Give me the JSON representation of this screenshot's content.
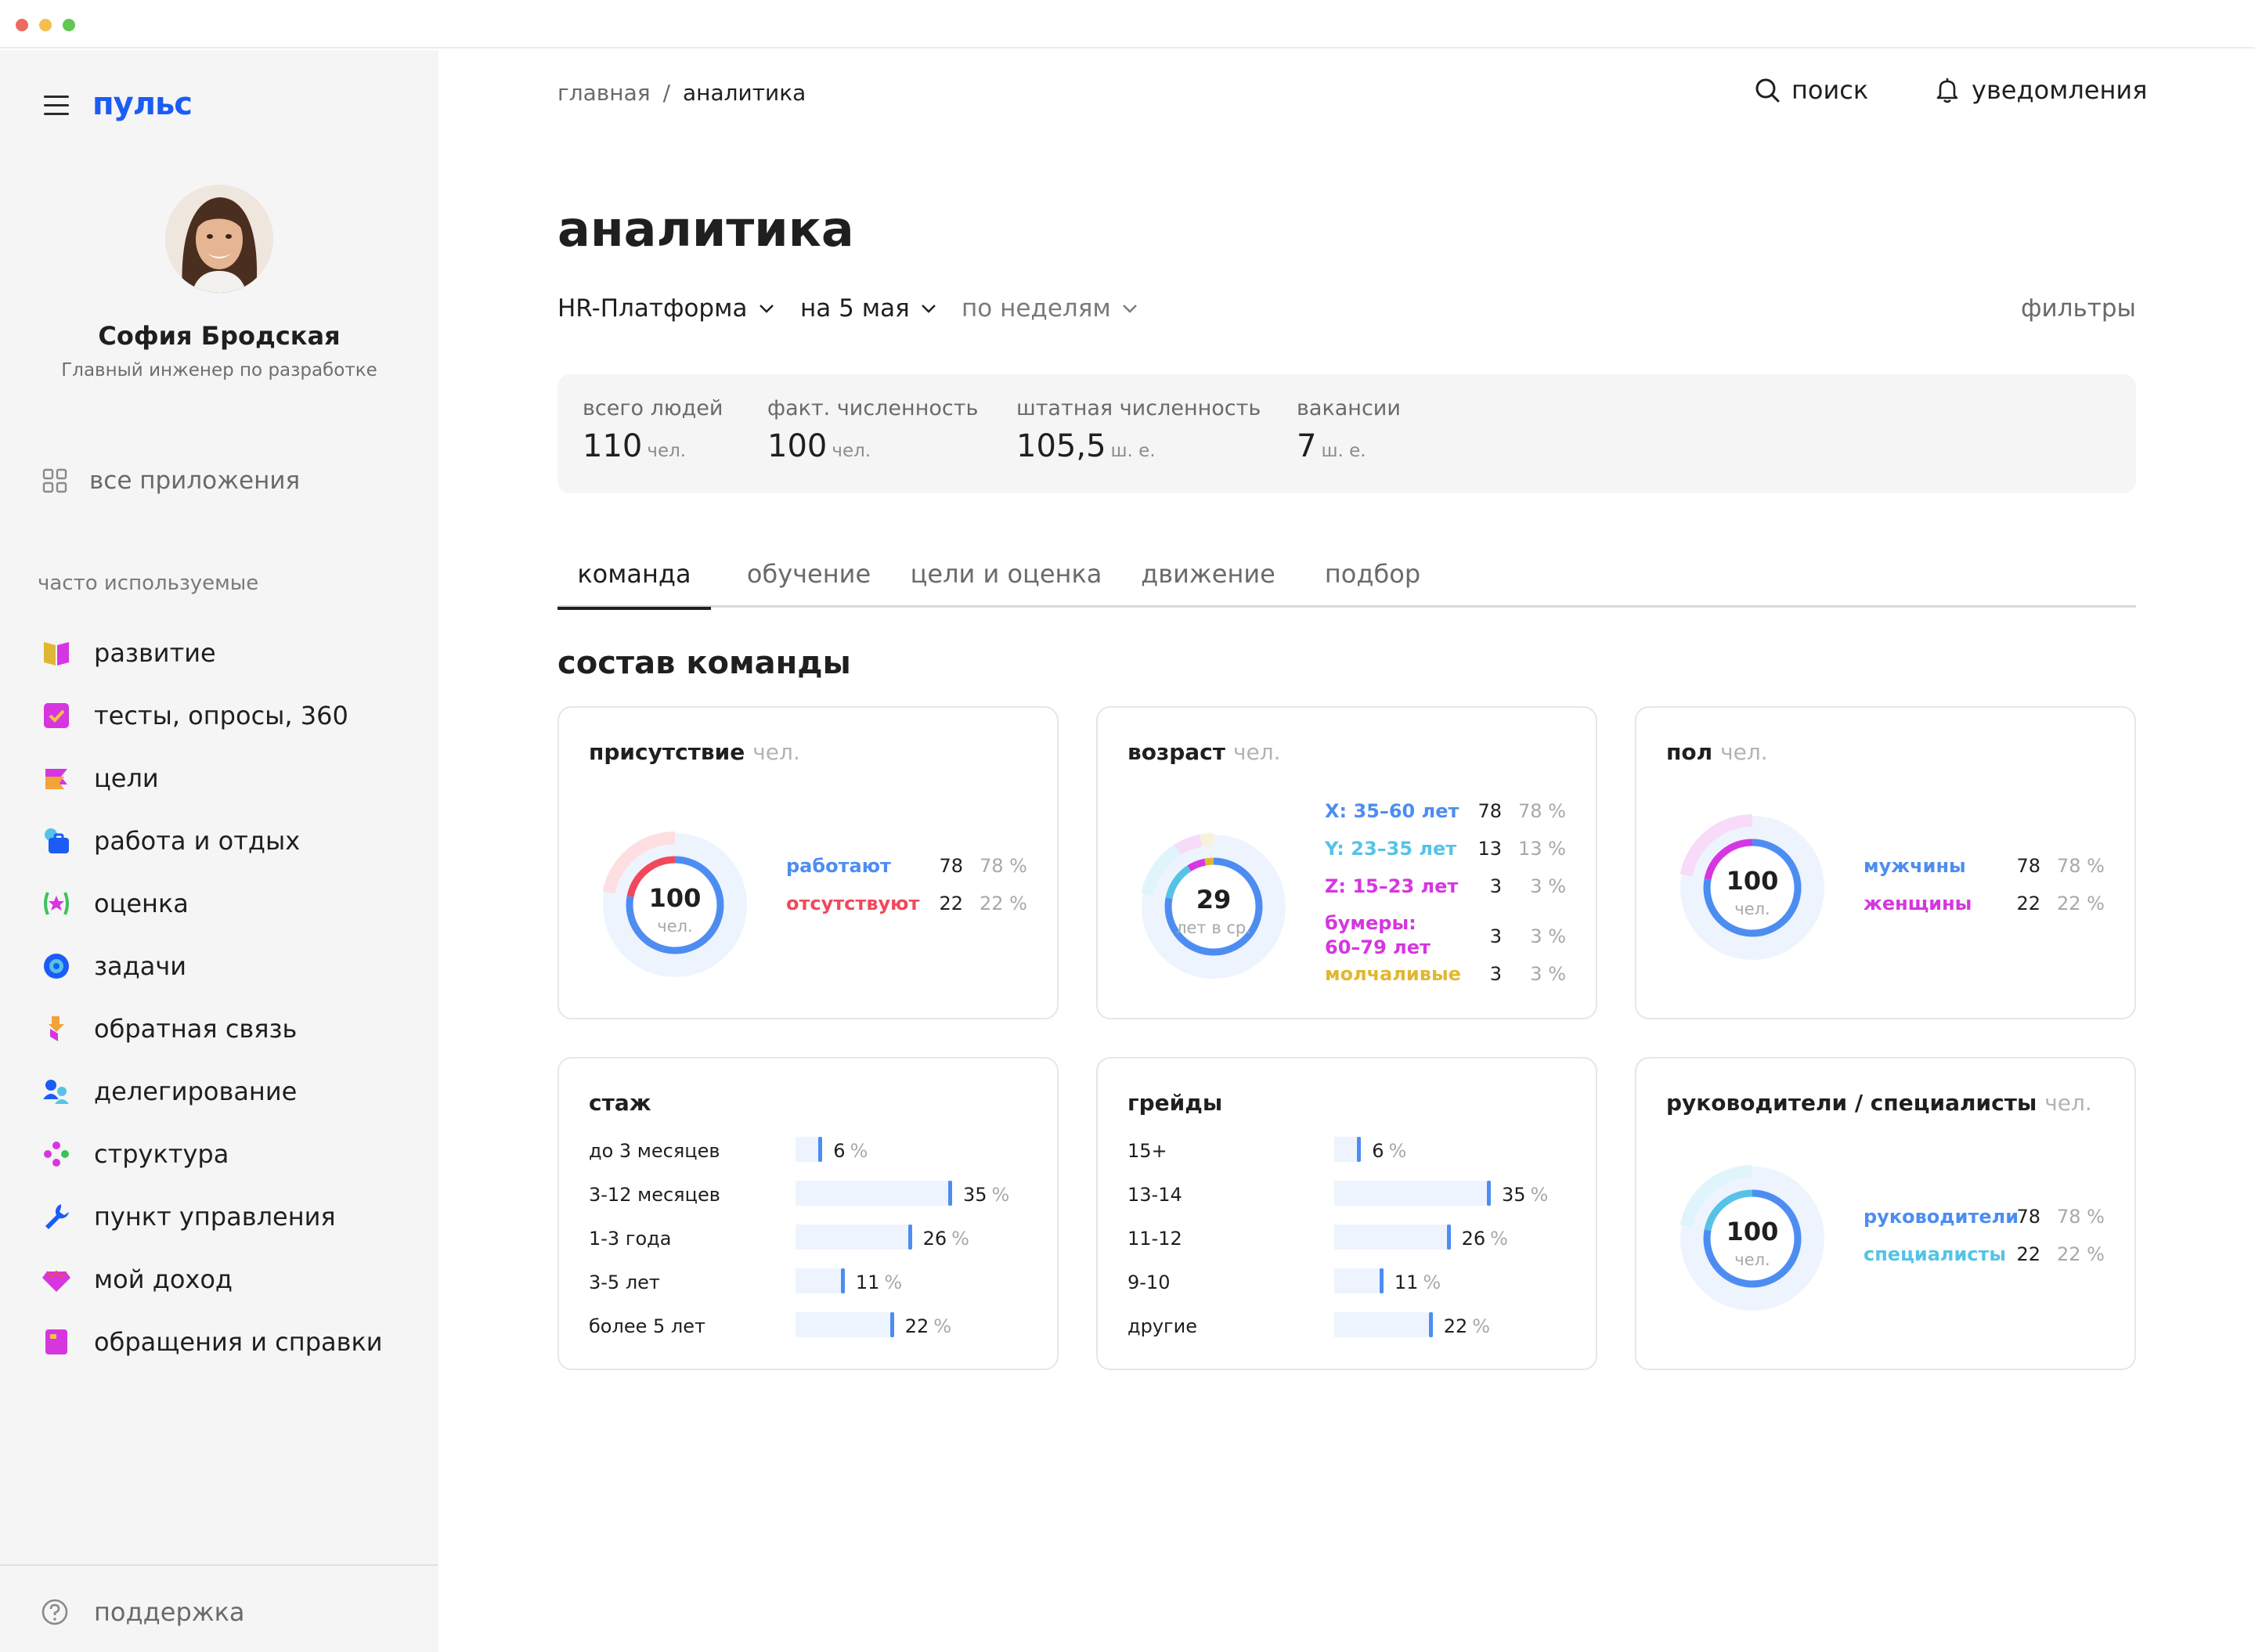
{
  "app": {
    "logo": "пульс"
  },
  "colors": {
    "accent": "#1a5cf5",
    "blue": "#4d8df2",
    "red": "#f2485b",
    "cyan": "#55c3e6",
    "magenta": "#d636e0",
    "yellow": "#e0b733",
    "track": "#eef4fd"
  },
  "profile": {
    "name": "София Бродская",
    "role": "Главный инженер по разработке"
  },
  "sidebar": {
    "all_apps": "все приложения",
    "section_label": "часто используемые",
    "items": [
      {
        "label": "развитие",
        "icon": "book-icon"
      },
      {
        "label": "тесты, опросы, 360",
        "icon": "checkbox-icon"
      },
      {
        "label": "цели",
        "icon": "flag-icon"
      },
      {
        "label": "работа и отдых",
        "icon": "briefcase-sun-icon"
      },
      {
        "label": "оценка",
        "icon": "star-icon"
      },
      {
        "label": "задачи",
        "icon": "target-icon"
      },
      {
        "label": "обратная связь",
        "icon": "feedback-icon"
      },
      {
        "label": "делегирование",
        "icon": "people-icon"
      },
      {
        "label": "структура",
        "icon": "structure-icon"
      },
      {
        "label": "пункт управления",
        "icon": "wrench-icon"
      },
      {
        "label": "мой доход",
        "icon": "diamond-icon"
      },
      {
        "label": "обращения и справки",
        "icon": "document-icon"
      }
    ],
    "support": "поддержка"
  },
  "header": {
    "breadcrumb": [
      "главная",
      "аналитика"
    ],
    "search": "поиск",
    "notifications": "уведомления"
  },
  "page": {
    "title": "аналитика",
    "filters": {
      "platform": "HR-Платформа",
      "date": "на 5 мая",
      "period": "по неделям",
      "filters_link": "фильтры"
    }
  },
  "kpis": [
    {
      "label": "всего людей",
      "value": "110",
      "unit": "чел."
    },
    {
      "label": "факт. численность",
      "value": "100",
      "unit": "чел."
    },
    {
      "label": "штатная численность",
      "value": "105,5",
      "unit": "ш. е."
    },
    {
      "label": "вакансии",
      "value": "7",
      "unit": "ш. е."
    }
  ],
  "tabs": [
    "команда",
    "обучение",
    "цели и оценка",
    "движение",
    "подбор"
  ],
  "section_title": "состав команды",
  "cards": {
    "presence": {
      "title": "присутствие",
      "unit": "чел.",
      "center_value": "100",
      "center_label": "чел.",
      "rows": [
        {
          "name": "работают",
          "value": "78",
          "pct": "78 %",
          "color": "#4d8df2",
          "fraction": 0.78
        },
        {
          "name": "отсутствуют",
          "value": "22",
          "pct": "22 %",
          "color": "#f2485b",
          "fraction": 0.22
        }
      ]
    },
    "age": {
      "title": "возраст",
      "unit": "чел.",
      "center_value": "29",
      "center_label": "лет в ср.",
      "rows": [
        {
          "name": "X: 35–60 лет",
          "value": "78",
          "pct": "78 %",
          "color": "#4d8df2",
          "fraction": 0.78
        },
        {
          "name": "Y: 23–35 лет",
          "value": "13",
          "pct": "13 %",
          "color": "#55c3e6",
          "fraction": 0.13
        },
        {
          "name": "Z: 15–23 лет",
          "value": "3",
          "pct": "3 %",
          "color": "#d636e0",
          "fraction": 0.03
        },
        {
          "name": "бумеры: 60–79 лет",
          "value": "3",
          "pct": "3 %",
          "color": "#d636e0",
          "fraction": 0.03
        },
        {
          "name": "молчаливые",
          "value": "3",
          "pct": "3 %",
          "color": "#e0b733",
          "fraction": 0.03
        }
      ]
    },
    "gender": {
      "title": "пол",
      "unit": "чел.",
      "center_value": "100",
      "center_label": "чел.",
      "rows": [
        {
          "name": "мужчины",
          "value": "78",
          "pct": "78 %",
          "color": "#4d8df2",
          "fraction": 0.78
        },
        {
          "name": "женщины",
          "value": "22",
          "pct": "22 %",
          "color": "#d636e0",
          "fraction": 0.22
        }
      ]
    },
    "tenure": {
      "title": "стаж",
      "rows": [
        {
          "label": "до 3 месяцев",
          "value": "6",
          "pct": "%",
          "fraction": 0.06
        },
        {
          "label": "3-12 месяцев",
          "value": "35",
          "pct": "%",
          "fraction": 0.35
        },
        {
          "label": "1-3 года",
          "value": "26",
          "pct": "%",
          "fraction": 0.26
        },
        {
          "label": "3-5 лет",
          "value": "11",
          "pct": "%",
          "fraction": 0.11
        },
        {
          "label": "более 5 лет",
          "value": "22",
          "pct": "%",
          "fraction": 0.22
        }
      ]
    },
    "grades": {
      "title": "грейды",
      "rows": [
        {
          "label": "15+",
          "value": "6",
          "pct": "%",
          "fraction": 0.06
        },
        {
          "label": "13-14",
          "value": "35",
          "pct": "%",
          "fraction": 0.35
        },
        {
          "label": "11-12",
          "value": "26",
          "pct": "%",
          "fraction": 0.26
        },
        {
          "label": "9-10",
          "value": "11",
          "pct": "%",
          "fraction": 0.11
        },
        {
          "label": "другие",
          "value": "22",
          "pct": "%",
          "fraction": 0.22
        }
      ]
    },
    "managers": {
      "title": "руководители / специалисты",
      "unit": "чел.",
      "center_value": "100",
      "center_label": "чел.",
      "rows": [
        {
          "name": "руководители",
          "value": "78",
          "pct": "78 %",
          "color": "#4d8df2",
          "fraction": 0.78
        },
        {
          "name": "специалисты",
          "value": "22",
          "pct": "22 %",
          "color": "#55c3e6",
          "fraction": 0.22
        }
      ]
    }
  }
}
